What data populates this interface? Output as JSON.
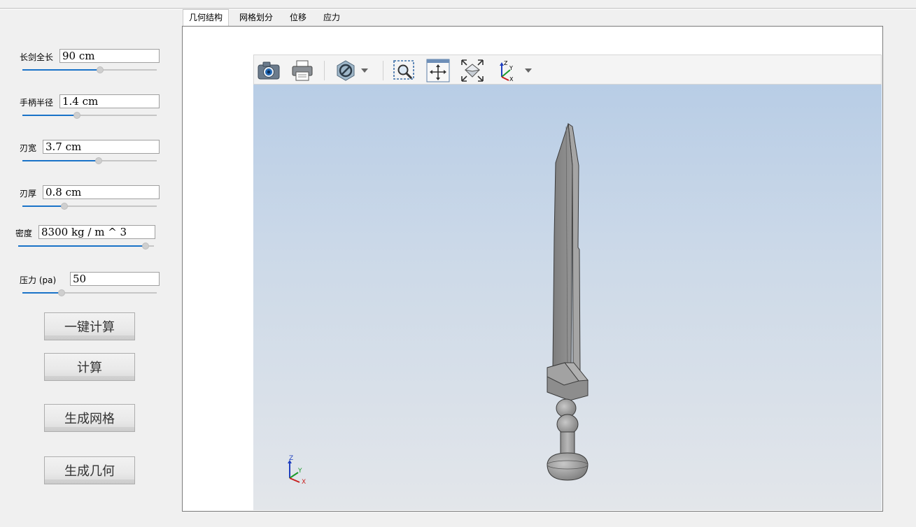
{
  "tabs": [
    "几何结构",
    "网格划分",
    "位移",
    "应力"
  ],
  "active_tab": "几何结构",
  "params": {
    "length": {
      "label": "长剑全长",
      "value": "90 cm",
      "slider_fraction": 0.58
    },
    "handle_radius": {
      "label": "手柄半径",
      "value": "1.4 cm",
      "slider_fraction": 0.4
    },
    "blade_width": {
      "label": "刃宽",
      "value": "3.7 cm",
      "slider_fraction": 0.57
    },
    "blade_thickness": {
      "label": "刃厚",
      "value": "0.8 cm",
      "slider_fraction": 0.3
    },
    "density": {
      "label": "密度",
      "value": "8300 kg / m ^ 3",
      "slider_fraction": 0.96
    },
    "pressure": {
      "label": "压力 (pa)",
      "value": "50",
      "slider_fraction": 0.28
    }
  },
  "buttons": {
    "compute_all": "一键计算",
    "compute": "计算",
    "generate_mesh": "生成网格",
    "generate_geometry": "生成几何"
  },
  "toolbar": {
    "icons": [
      "camera-icon",
      "print-icon",
      "section-disable-icon",
      "dropdown-arrow-icon",
      "zoom-box-icon",
      "pan-icon",
      "fit-all-icon",
      "axes-view-icon",
      "dropdown-arrow-icon"
    ]
  },
  "axes_triad": {
    "x": "X",
    "y": "Y",
    "z": "Z"
  },
  "colors": {
    "slider_fill": "#1a73c8",
    "scene_top": "#b8cde6",
    "scene_bottom": "#e3e6ea",
    "model_gray": "#8c8c8c"
  }
}
